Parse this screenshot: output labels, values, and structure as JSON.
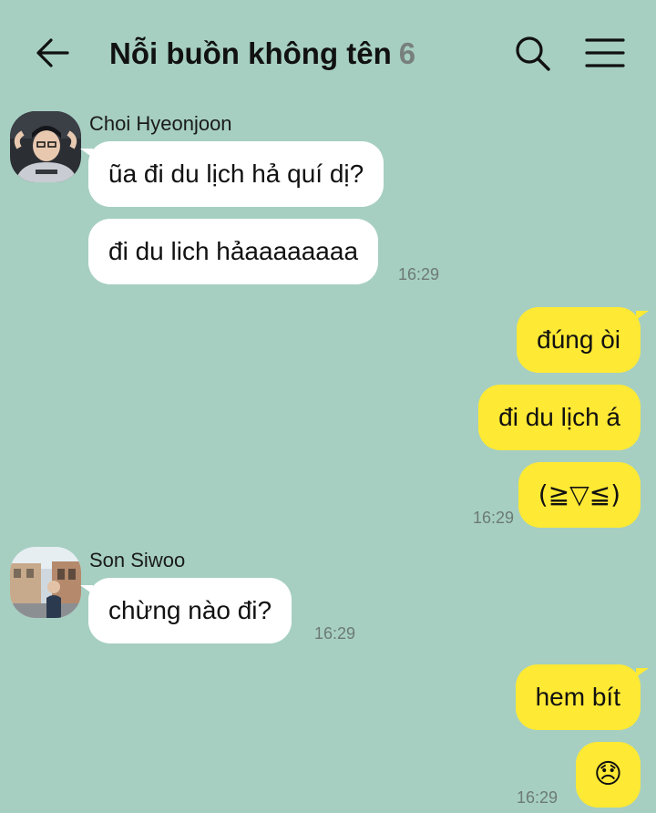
{
  "header": {
    "title": "Nỗi buồn không tên",
    "member_count": "6",
    "icons": [
      "arrow-left-icon",
      "search-icon",
      "hamburger-menu-icon"
    ]
  },
  "colors": {
    "background": "#a6cfc1",
    "incoming_bubble": "#ffffff",
    "outgoing_bubble": "#fee934",
    "timestamp": "#6c7a75"
  },
  "messages": {
    "group1": {
      "sender": "Choi Hyeonjoon",
      "texts": [
        "ũa đi du lịch hả quí dị?",
        "đi du lich hảaaaaaaaa"
      ],
      "time": "16:29"
    },
    "group2": {
      "texts": [
        "đúng òi",
        "đi du lịch á",
        "(≧▽≦)"
      ],
      "time": "16:29"
    },
    "group3": {
      "sender": "Son Siwoo",
      "texts": [
        "chừng nào đi?"
      ],
      "time": "16:29"
    },
    "group4": {
      "texts": [
        "hem bít",
        "😞"
      ],
      "time": "16:29"
    }
  }
}
